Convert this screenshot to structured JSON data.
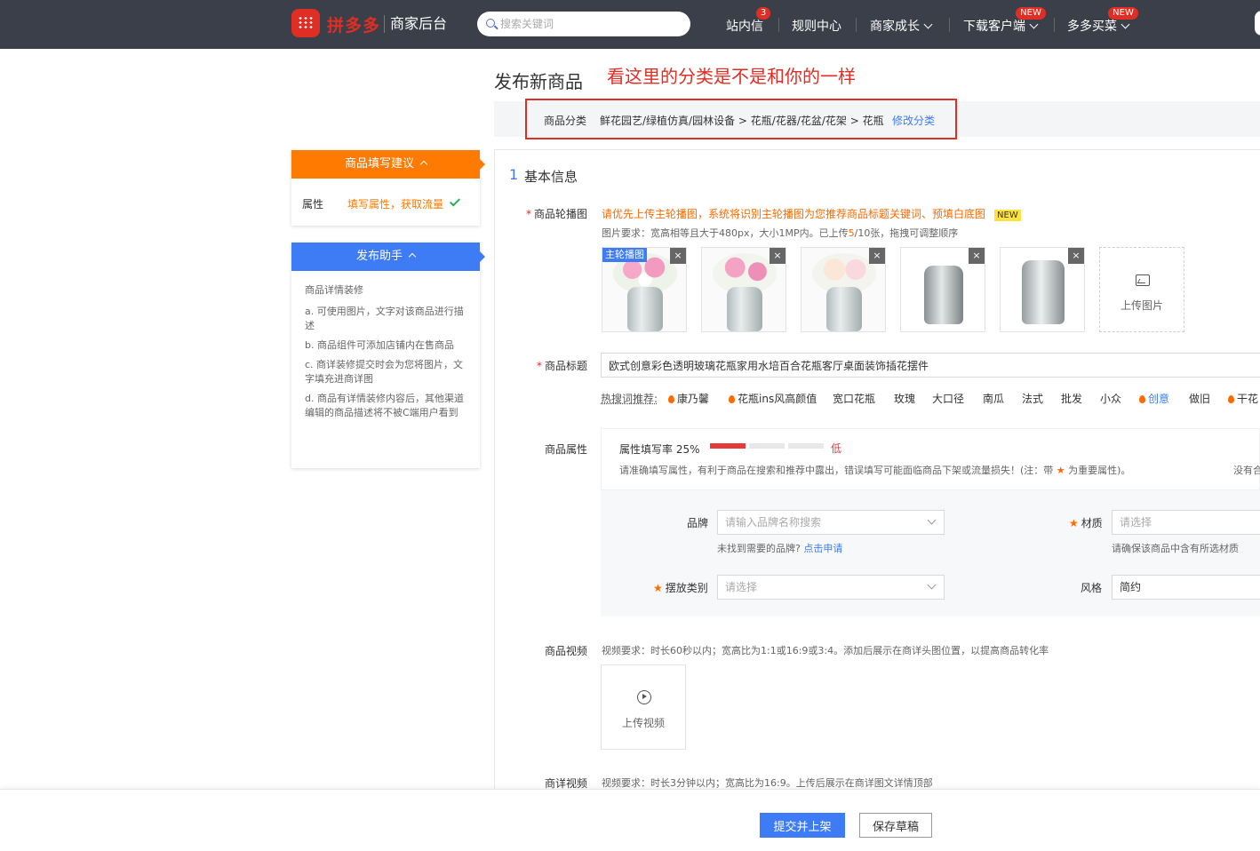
{
  "header": {
    "brand": "拼多多",
    "brand_sub": "商家后台",
    "search_placeholder": "搜索关键词",
    "nav": {
      "inbox": "站内信",
      "inbox_badge": "3",
      "rules": "规则中心",
      "growth": "商家成长",
      "download": "下载客户端",
      "download_badge": "NEW",
      "duoduo": "多多买菜",
      "duoduo_badge": "NEW"
    }
  },
  "page": {
    "title": "发布新商品",
    "annotation": "看这里的分类是不是和你的一样"
  },
  "category": {
    "label": "商品分类",
    "path": "鲜花园艺/绿植仿真/园林设备 > 花瓶/花器/花盆/花架 > 花瓶",
    "edit": "修改分类"
  },
  "suggest_panel": {
    "title": "商品填写建议",
    "item_label": "属性",
    "item_text": "填写属性，获取流量"
  },
  "helper_panel": {
    "title": "发布助手",
    "heading": "商品详情装修",
    "tips": [
      "a. 可使用图片，文字对该商品进行描述",
      "b. 商品组件可添加店铺内在售商品",
      "c. 商详装修提交时会为您将图片，文字填充进商详图",
      "d. 商品有详情装修内容后，其他渠道编辑的商品描述将不被C端用户看到"
    ]
  },
  "basic": {
    "num": "1",
    "title": "基本信息"
  },
  "carousel": {
    "label": "商品轮播图",
    "notice": "请优先上传主轮播图，系统将识别主轮播图为您推荐商品标题关键词、预填白底图",
    "new_tag": "NEW",
    "req_prefix": "图片要求：宽高相等且大于480px，大小1MP内。已上传",
    "req_count": "5",
    "req_suffix": "/10张，拖拽可调整顺序",
    "main_tag": "主轮播图",
    "close": "×",
    "upload": "上传图片"
  },
  "title_field": {
    "label": "商品标题",
    "value": "欧式创意彩色透明玻璃花瓶家用水培百合花瓶客厅桌面装饰插花摆件",
    "hot_label": "热搜词推荐:",
    "hot_words": [
      "康乃馨",
      "花瓶ins风高颜值",
      "宽口花瓶",
      "玫瑰",
      "大口径",
      "南瓜",
      "法式",
      "批发",
      "小众",
      "创意",
      "做旧",
      "干花"
    ]
  },
  "attributes": {
    "label": "商品属性",
    "fill_rate": "属性填写率 25%",
    "level": "低",
    "fill_fraction": 0.25,
    "warning": "请准确填写属性，有利于商品在搜索和推荐中露出，错误填写可能面临商品下架或流量损失！(注：带",
    "warning_star": "★",
    "warning_end": "为重要属性)。",
    "right_cut": "没有合",
    "brand_label": "品牌",
    "brand_placeholder": "请输入品牌名称搜索",
    "brand_hint": "未找到需要的品牌?",
    "brand_apply": "点击申请",
    "material_label": "材质",
    "material_placeholder": "请选择",
    "material_hint": "请确保该商品中含有所选材质",
    "placement_label": "摆放类别",
    "placement_placeholder": "请选择",
    "style_label": "风格",
    "style_value": "简约",
    "star": "★"
  },
  "video": {
    "label": "商品视频",
    "req": "视频要求：时长60秒以内；宽高比为1:1或16:9或3:4。添加后展示在商详头图位置，以提高商品转化率",
    "upload": "上传视频"
  },
  "detail_video": {
    "label": "商详视频",
    "req": "视频要求：时长3分钟以内；宽高比为16:9。上传后展示在商详图文详情顶部"
  },
  "footer": {
    "submit": "提交并上架",
    "draft": "保存草稿"
  }
}
